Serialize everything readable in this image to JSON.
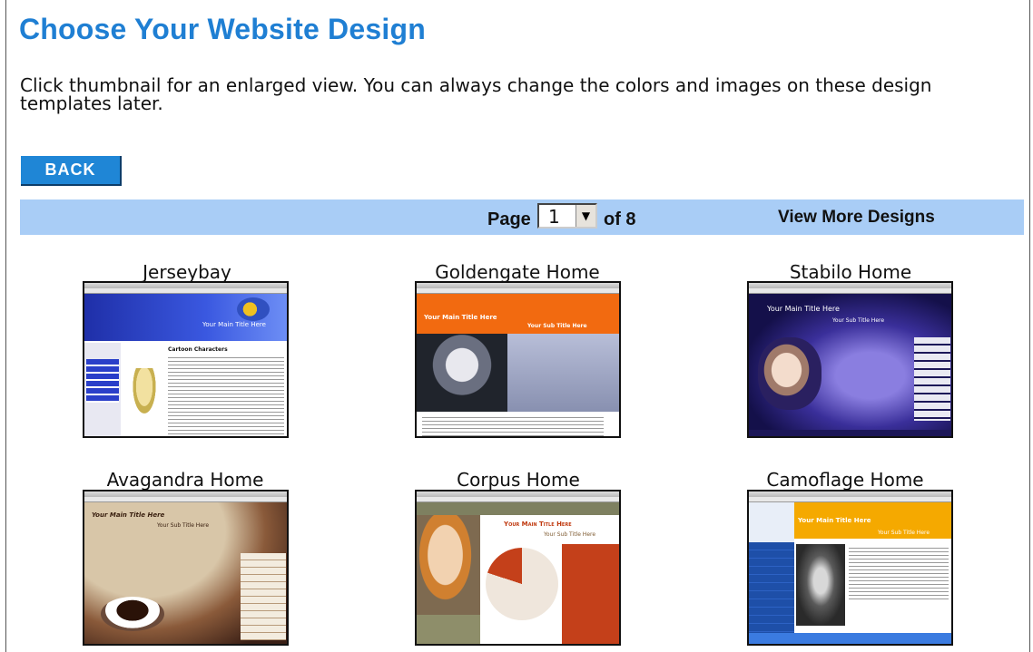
{
  "header": {
    "title": "Choose Your Website Design"
  },
  "intro": {
    "text": "Click thumbnail for an enlarged view. You can always change the colors and images on these design templates later."
  },
  "toolbar": {
    "back_label": "BACK"
  },
  "pager": {
    "page_label": "Page",
    "current_page": "1",
    "of_label": "of 8",
    "more_designs_label": "View More Designs"
  },
  "designs": [
    {
      "name": "Jerseybay",
      "thumb_text": "Your Main Title Here",
      "thumb_sub": "Cartoon Characters"
    },
    {
      "name": "Goldengate Home",
      "thumb_text": "Your Main Title Here",
      "thumb_sub": "Your Sub Title Here"
    },
    {
      "name": "Stabilo Home",
      "thumb_text": "Your Main Title Here",
      "thumb_sub": "Your Sub Title Here"
    },
    {
      "name": "Avagandra Home",
      "thumb_text": "Your Main Title Here",
      "thumb_sub": "Your Sub Title Here"
    },
    {
      "name": "Corpus Home",
      "thumb_text": "Your Main Title Here",
      "thumb_sub": "Your Sub Title Here"
    },
    {
      "name": "Camoflage Home",
      "thumb_text": "Your Main Title Here",
      "thumb_sub": "Your Sub Title Here"
    }
  ],
  "colors": {
    "title_blue": "#1f7fd3",
    "button_blue": "#1f86d6",
    "pager_bar": "#a9cdf6"
  }
}
